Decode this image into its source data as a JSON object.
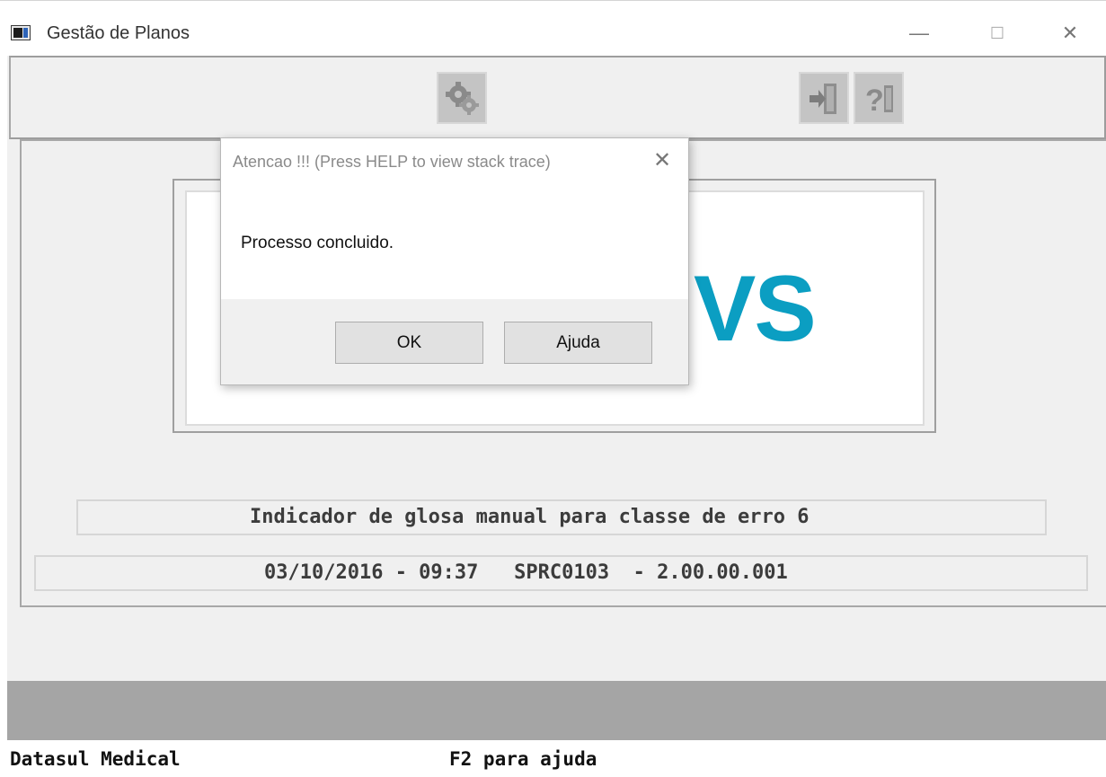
{
  "window": {
    "title": "Gestão de Planos",
    "minimize_glyph": "—",
    "maximize_glyph": "☐",
    "close_glyph": "✕"
  },
  "toolbar": {
    "buttons": [
      {
        "name": "execute-icon"
      },
      {
        "name": "exit-icon"
      },
      {
        "name": "help-icon"
      }
    ]
  },
  "logo": {
    "visible_text": "VS",
    "color": "#0b9ec2"
  },
  "main": {
    "indicator_text": "Indicador de glosa manual para classe de erro 6",
    "version_text": "03/10/2016 - 09:37   SPRC0103  - 2.00.00.001"
  },
  "statusbar": {
    "left_text": "Datasul Medical",
    "center_text": "F2 para ajuda"
  },
  "dialog": {
    "title": "Atencao !!! (Press HELP to view stack trace)",
    "close_glyph": "✕",
    "message": "Processo concluido.",
    "ok_label": "OK",
    "help_label": "Ajuda"
  }
}
